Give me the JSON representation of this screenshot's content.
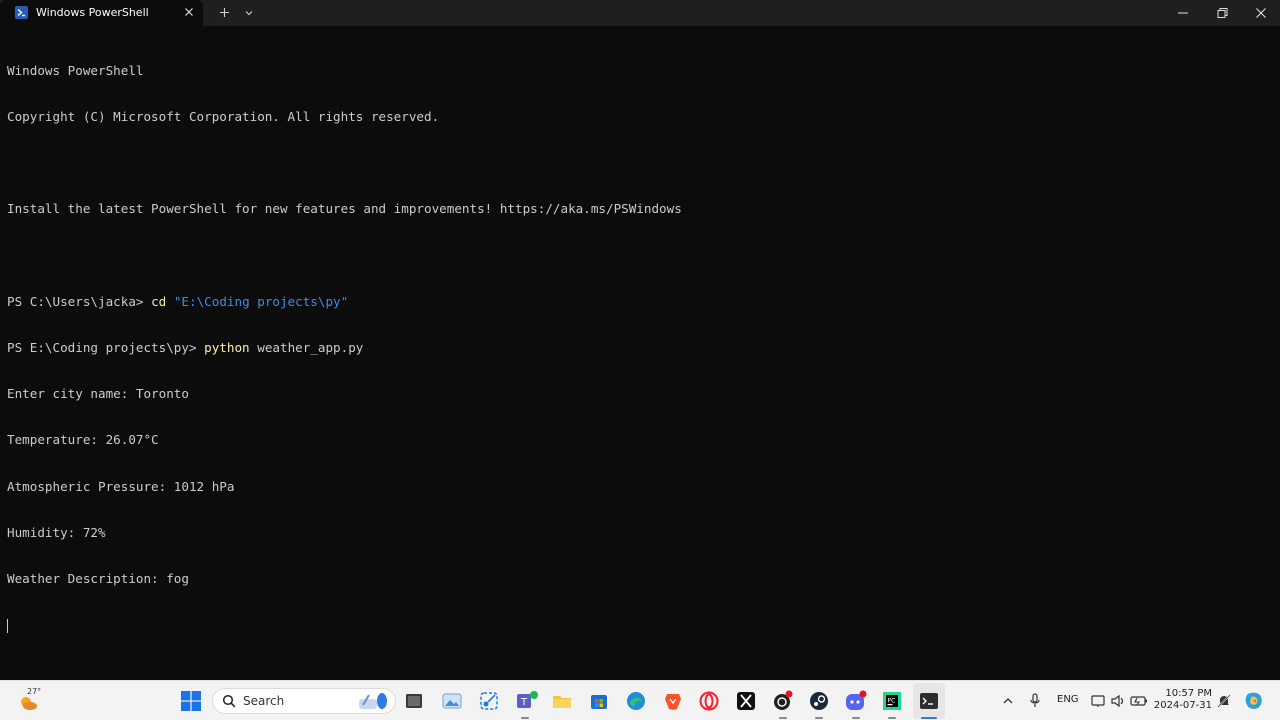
{
  "window": {
    "tab_title": "Windows PowerShell"
  },
  "terminal": {
    "banner_title": "Windows PowerShell",
    "copyright": "Copyright (C) Microsoft Corporation. All rights reserved.",
    "install_msg": "Install the latest PowerShell for new features and improvements! https://aka.ms/PSWindows",
    "prompt1": "PS C:\\Users\\jacka> ",
    "cmd1": "cd",
    "cmd1_arg": "\"E:\\Coding projects\\py\"",
    "prompt2": "PS E:\\Coding projects\\py> ",
    "cmd2": "python",
    "cmd2_arg": "weather_app.py",
    "output": [
      "Enter city name: Toronto",
      "Temperature: 26.07°C",
      "Atmospheric Pressure: 1012 hPa",
      "Humidity: 72%",
      "Weather Description: fog"
    ]
  },
  "taskbar": {
    "weather_temp": "27°",
    "search_label": "Search",
    "language": "ENG",
    "time": "10:57 PM",
    "date": "2024-07-31"
  },
  "colors": {
    "terminal_bg": "#0c0c0c",
    "text": "#cccccc",
    "command": "#f9f1a5",
    "string": "#3b8eea"
  }
}
